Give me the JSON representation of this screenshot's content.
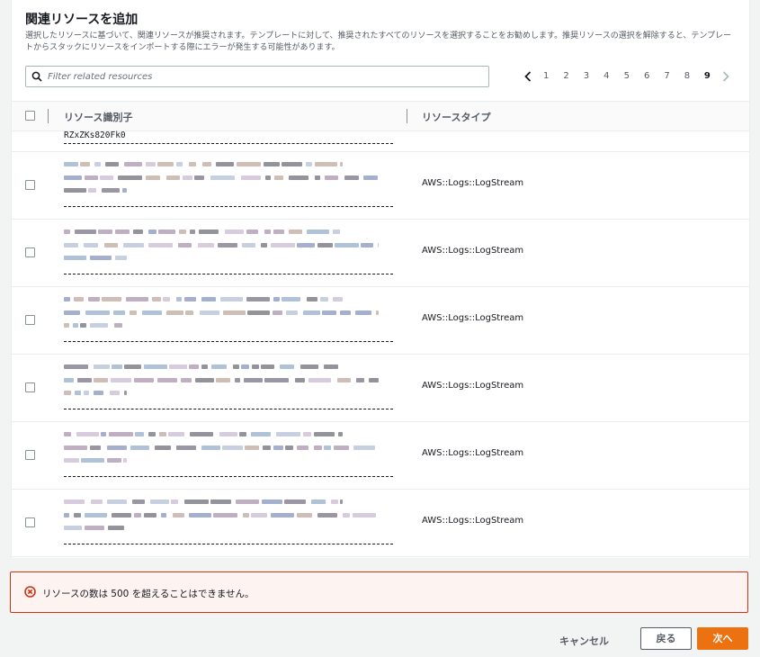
{
  "dialog": {
    "title": "関連リソースを追加",
    "description": "選択したリソースに基づいて、関連リソースが推奨されます。テンプレートに対して、推奨されたすべてのリソースを選択することをお勧めします。推奨リソースの選択を解除すると、テンプレートからスタックにリソースをインポートする際にエラーが発生する可能性があります。"
  },
  "search": {
    "placeholder": "Filter related resources",
    "value": ""
  },
  "pagination": {
    "pages": [
      "1",
      "2",
      "3",
      "4",
      "5",
      "6",
      "7",
      "8",
      "9"
    ],
    "current": "9"
  },
  "table": {
    "columns": {
      "identifier": "リソース識別子",
      "type": "リソースタイプ"
    },
    "first_row_partial_identifier": "RZxZKs820Fk0",
    "rows": [
      {
        "type": "AWS::Logs::LogStream",
        "checked": false
      },
      {
        "type": "AWS::Logs::LogStream",
        "checked": false
      },
      {
        "type": "AWS::Logs::LogStream",
        "checked": false
      },
      {
        "type": "AWS::Logs::LogStream",
        "checked": false
      },
      {
        "type": "AWS::Logs::LogStream",
        "checked": false
      },
      {
        "type": "AWS::Logs::LogStream",
        "checked": false
      }
    ]
  },
  "alert": {
    "icon": "error-circle-icon",
    "message": "リソースの数は 500 を超えることはできません。"
  },
  "footer": {
    "cancel_label": "キャンセル",
    "back_label": "戻る",
    "next_label": "次へ"
  },
  "colors": {
    "accent": "#ec7211",
    "error": "#d13212",
    "text": "#16191f",
    "muted": "#545b64"
  }
}
